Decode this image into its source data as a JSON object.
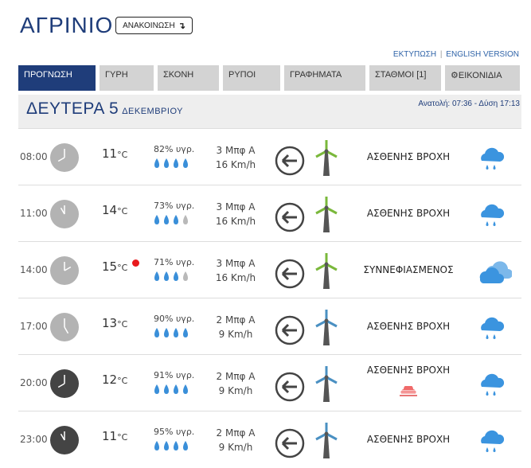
{
  "header": {
    "city": "ΑΓΡΙΝΙΟ",
    "announcement_label": "ΑΝΑΚΟΙΝΩΣΗ",
    "print_link": "ΕΚΤΥΠΩΣΗ",
    "link_separator": "|",
    "english_link": "ENGLISH VERSION"
  },
  "tabs": [
    {
      "label": "ΠΡΟΓΝΩΣΗ"
    },
    {
      "label": "ΓΥΡΗ"
    },
    {
      "label": "ΣΚΟΝΗ"
    },
    {
      "label": "ΡΥΠΟΙ"
    },
    {
      "label": "ΓΡΑΦΗΜΑΤΑ"
    },
    {
      "label": "ΣΤΑΘΜΟΙ [1]"
    },
    {
      "label": "ΕΙΚΟΝΙΔΙΑ"
    }
  ],
  "day": {
    "name": "ΔΕΥΤΕΡΑ 5",
    "month": "ΔΕΚΕΜΒΡΙΟΥ",
    "sun": "Ανατολή: 07:36  - Δύση 17:13"
  },
  "colors": {
    "accent": "#1f3d7a",
    "rain": "#3a8fd9",
    "cloud": "#3b94df",
    "turbine_green": "#7ab83b",
    "turbine_blue": "#4a90c2",
    "alert": "#e8191c"
  },
  "rows": [
    {
      "time": "08:00",
      "temp": "11",
      "unit": "°C",
      "humidity": "82% υγρ.",
      "humidity_level": 4,
      "wind_bft": "3 Μπφ Α",
      "wind_kmh": "16 Km/h",
      "condition": "ΑΣΘΕΝΗΣ ΒΡΟΧΗ",
      "icon": "rain-icon",
      "clock": "light",
      "hour": 8
    },
    {
      "time": "11:00",
      "temp": "14",
      "unit": "°C",
      "humidity": "73% υγρ.",
      "humidity_level": 3,
      "wind_bft": "3 Μπφ Α",
      "wind_kmh": "16 Km/h",
      "condition": "ΑΣΘΕΝΗΣ ΒΡΟΧΗ",
      "icon": "rain-icon",
      "clock": "light",
      "hour": 11
    },
    {
      "time": "14:00",
      "temp": "15",
      "unit": "°C",
      "humidity": "71% υγρ.",
      "humidity_level": 3,
      "wind_bft": "3 Μπφ Α",
      "wind_kmh": "16 Km/h",
      "condition": "ΣΥΝΝΕΦΙΑΣΜΕΝΟΣ",
      "icon": "cloudy-icon",
      "clock": "light",
      "hour": 14
    },
    {
      "time": "17:00",
      "temp": "13",
      "unit": "°C",
      "humidity": "90% υγρ.",
      "humidity_level": 4,
      "wind_bft": "2 Μπφ Α",
      "wind_kmh": "9 Km/h",
      "condition": "ΑΣΘΕΝΗΣ ΒΡΟΧΗ",
      "icon": "rain-icon",
      "clock": "light",
      "hour": 17
    },
    {
      "time": "20:00",
      "temp": "12",
      "unit": "°C",
      "humidity": "91% υγρ.",
      "humidity_level": 4,
      "wind_bft": "2 Μπφ Α",
      "wind_kmh": "9 Km/h",
      "condition": "ΑΣΘΕΝΗΣ ΒΡΟΧΗ",
      "icon": "rain-icon",
      "clock": "dark",
      "hour": 20
    },
    {
      "time": "23:00",
      "temp": "11",
      "unit": "°C",
      "humidity": "95% υγρ.",
      "humidity_level": 4,
      "wind_bft": "2 Μπφ Α",
      "wind_kmh": "9 Km/h",
      "condition": "ΑΣΘΕΝΗΣ ΒΡΟΧΗ",
      "icon": "rain-icon",
      "clock": "dark",
      "hour": 23
    }
  ]
}
